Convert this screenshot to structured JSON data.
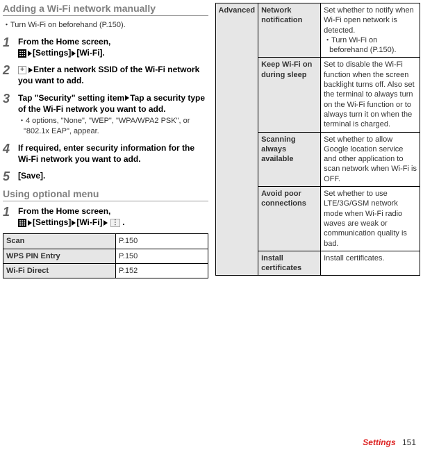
{
  "left": {
    "heading1": "Adding a Wi-Fi network manually",
    "pre_bullet": "Turn Wi-Fi on beforehand (P.150).",
    "steps1": [
      {
        "html_bind": "s1a"
      },
      {
        "html_bind": "s1b"
      },
      {
        "html_bind": "s1c",
        "sub": "4 options, \"None\", \"WEP\", \"WPA/WPA2 PSK\", or \"802.1x EAP\", appear."
      },
      {
        "html_bind": "s1d"
      },
      {
        "html_bind": "s1e"
      }
    ],
    "s1a": "From the Home screen,",
    "s1a_tail": "[Settings]",
    "s1a_tail2": "[Wi-Fi].",
    "s1b_tail": "Enter a network SSID of the Wi-Fi network you want to add.",
    "s1c": "Tap \"Security\" setting item",
    "s1c_tail": "Tap a security type of the Wi-Fi network you want to add.",
    "s1d": "If required, enter security information for the Wi-Fi network you want to add.",
    "s1e": "[Save].",
    "heading2": "Using optional menu",
    "s2a_pre": "From the Home screen,",
    "s2a_mid": "[Settings]",
    "s2a_tail": "[Wi-Fi]",
    "small_table": [
      {
        "label": "Scan",
        "val": "P.150"
      },
      {
        "label": "WPS PIN Entry",
        "val": "P.150"
      },
      {
        "label": "Wi-Fi Direct",
        "val": "P.152"
      }
    ]
  },
  "right": {
    "category": "Advanced",
    "rows": [
      {
        "opt": "Network notification",
        "desc": "Set whether to notify when Wi-Fi open network is detected.",
        "bullet": "Turn Wi-Fi on beforehand (P.150)."
      },
      {
        "opt": "Keep Wi-Fi on during sleep",
        "desc": "Set to disable the Wi-Fi function when the screen backlight turns off. Also set the terminal to always turn on the Wi-Fi function or to always turn it on when the terminal is charged."
      },
      {
        "opt": "Scanning always available",
        "desc": "Set whether to allow Google location service and other application to scan network when Wi-Fi is OFF."
      },
      {
        "opt": "Avoid poor connections",
        "desc": "Set whether to use LTE/3G/GSM network mode when Wi-Fi radio waves are weak or communication quality is bad."
      },
      {
        "opt": "Install certificates",
        "desc": "Install certificates."
      }
    ]
  },
  "footer": {
    "section": "Settings",
    "page": "151"
  }
}
